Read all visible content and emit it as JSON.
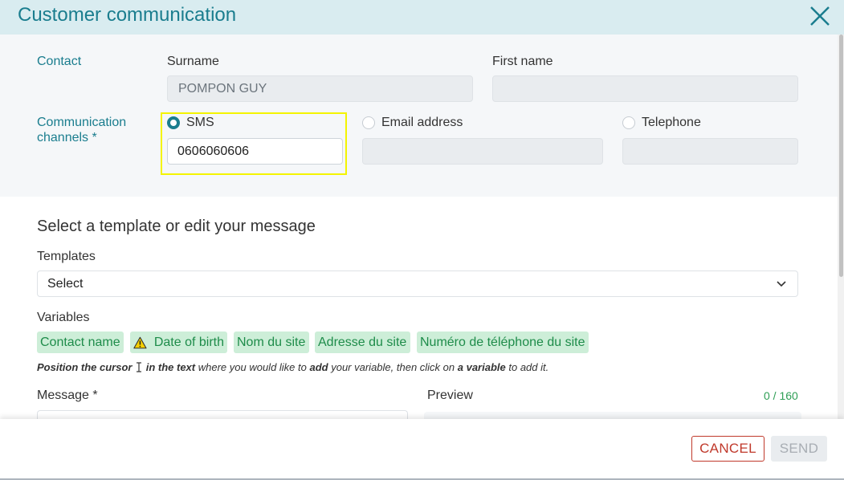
{
  "header": {
    "title": "Customer communication"
  },
  "contact": {
    "section_label": "Contact",
    "surname_label": "Surname",
    "surname_value": "POMPON GUY",
    "firstname_label": "First name",
    "firstname_value": ""
  },
  "channels": {
    "section_label_line1": "Communication",
    "section_label_line2": "channels *",
    "sms_label": "SMS",
    "sms_value": "0606060606",
    "email_label": "Email address",
    "email_value": "",
    "telephone_label": "Telephone",
    "telephone_value": "",
    "selected": "SMS"
  },
  "message": {
    "title": "Select a template or edit your message",
    "templates_label": "Templates",
    "templates_selected": "Select",
    "variables_label": "Variables",
    "variables": [
      "Contact name",
      "Date of birth",
      "Nom du site",
      "Adresse du site",
      "Numéro de téléphone du site"
    ],
    "hint": {
      "p1": "Position the cursor",
      "p2": "in the text",
      "p3": " where you would like to ",
      "p4": "add",
      "p5": " your variable, then click on ",
      "p6": "a variable",
      "p7": " to add it."
    },
    "message_label": "Message *",
    "preview_label": "Preview",
    "counter": "0 / 160"
  },
  "footer": {
    "cancel_label": "CANCEL",
    "send_label": "SEND"
  },
  "colors": {
    "accent": "#1a7d8e",
    "header_bg": "#d9ecf0",
    "chip_bg": "#cdeed8",
    "chip_text": "#1e8c4a",
    "cancel": "#c0392b",
    "highlight": "#f4f400"
  }
}
